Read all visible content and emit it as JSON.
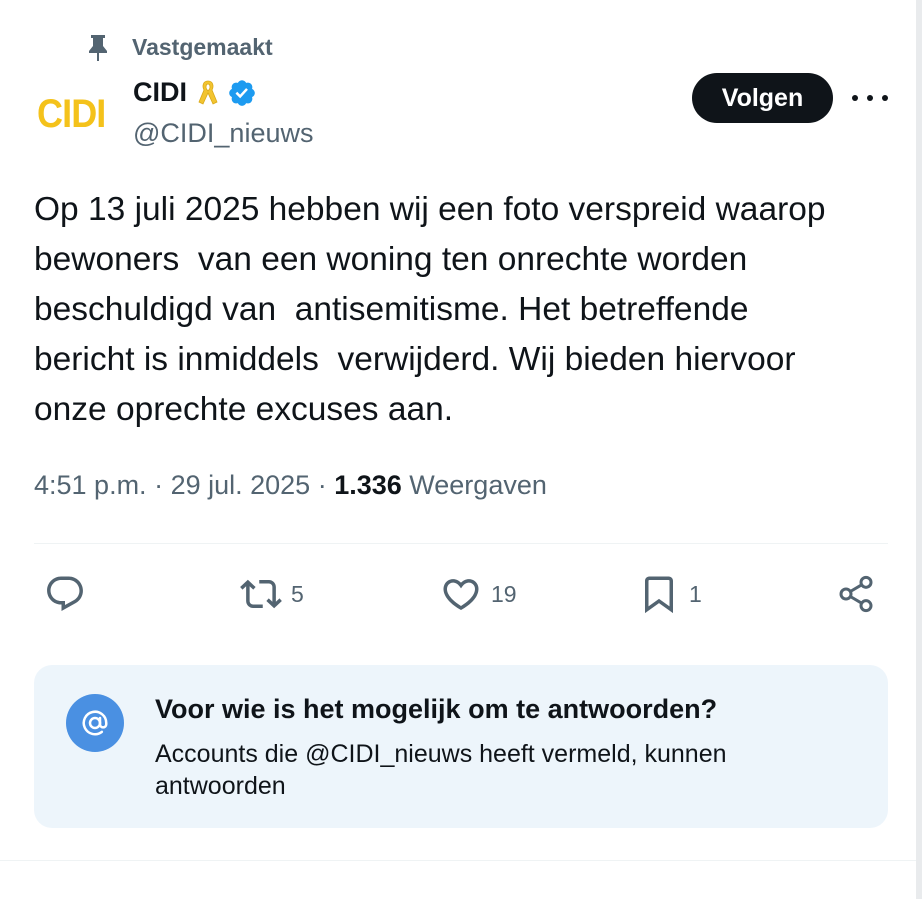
{
  "pinned": {
    "label": "Vastgemaakt",
    "icon": "pin-icon"
  },
  "account": {
    "logo_text": "CIDI",
    "logo_color": "#f4c21b",
    "display_name": "CIDI",
    "handle": "@CIDI_nieuws",
    "badges": [
      "yellow-ribbon-icon",
      "verified-badge-icon"
    ]
  },
  "header": {
    "follow_label": "Volgen",
    "more_icon": "more-options-icon"
  },
  "tweet": {
    "lines": [
      "Op 13 juli 2025 hebben wij een foto verspreid waarop",
      "bewoners  van een woning ten onrechte worden",
      "beschuldigd van  antisemitisme. Het betreffende",
      "bericht is inmiddels  verwijderd. Wij bieden hiervoor",
      "onze oprechte excuses aan."
    ],
    "time": "4:51 p.m.",
    "date": "29 jul. 2025",
    "views_count": "1.336",
    "views_label": "Weergaven"
  },
  "actions": {
    "reply": {
      "icon": "reply-icon",
      "count": ""
    },
    "repost": {
      "icon": "repost-icon",
      "count": "5"
    },
    "like": {
      "icon": "heart-icon",
      "count": "19"
    },
    "bookmark": {
      "icon": "bookmark-icon",
      "count": "1"
    },
    "share": {
      "icon": "share-icon"
    }
  },
  "reply_restriction": {
    "icon": "at-icon",
    "title": "Voor wie is het mogelijk om te antwoorden?",
    "description": "Accounts die @CIDI_nieuws heeft vermeld, kunnen antwoorden"
  },
  "colors": {
    "text_primary": "#0f1419",
    "text_secondary": "#536471",
    "accent_blue": "#1d9bf0",
    "reply_box_bg": "#edf5fb"
  }
}
